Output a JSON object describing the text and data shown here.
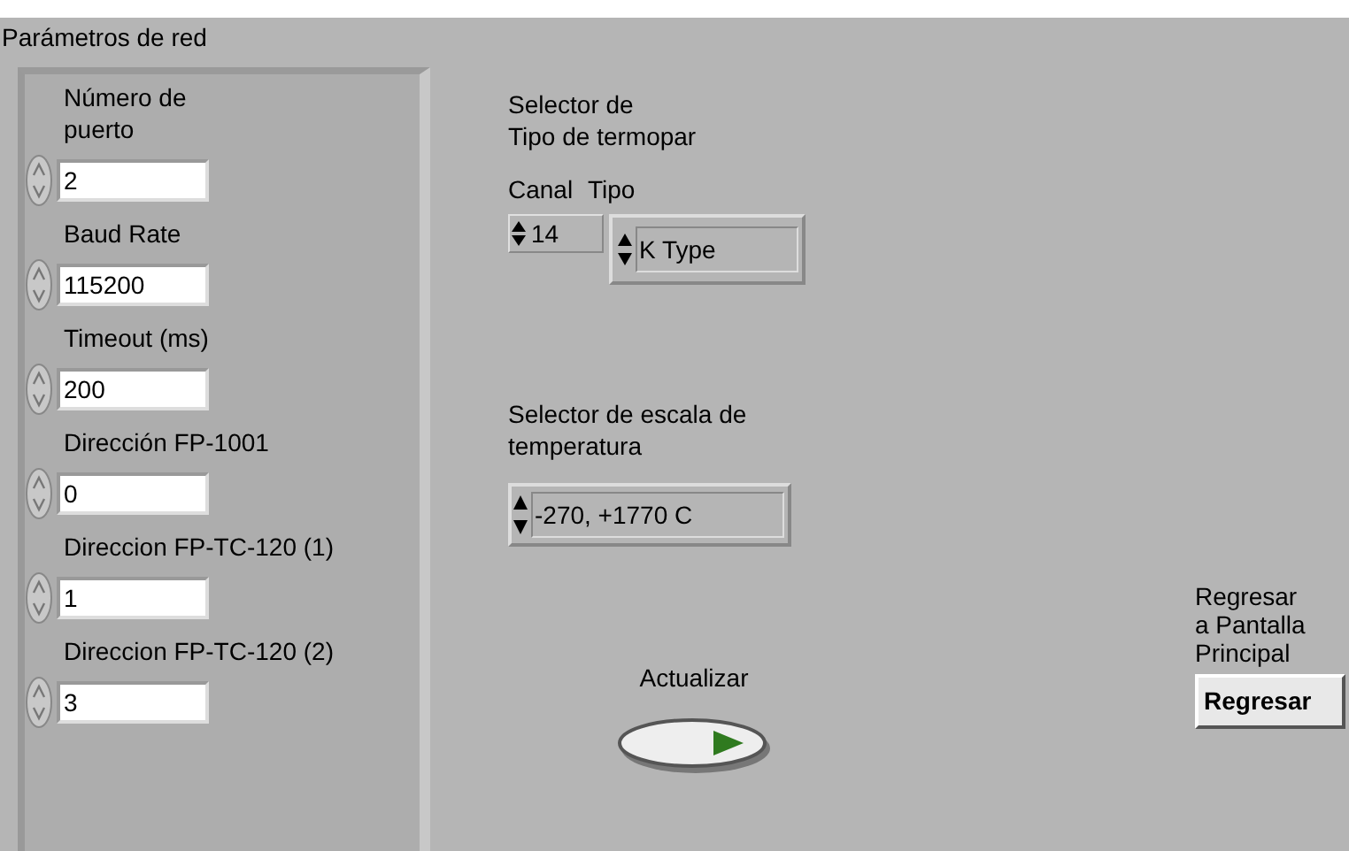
{
  "network_panel": {
    "title": "Parámetros de red",
    "controls": [
      {
        "label": "Número de\npuerto",
        "value": "2"
      },
      {
        "label": "Baud Rate",
        "value": "115200"
      },
      {
        "label": "Timeout (ms)",
        "value": "200"
      },
      {
        "label": "Dirección FP-1001",
        "value": "0"
      },
      {
        "label": "Direccion FP-TC-120 (1)",
        "value": "1"
      },
      {
        "label": "Direccion FP-TC-120 (2)",
        "value": "3"
      }
    ]
  },
  "thermocouple_selector": {
    "title": "Selector de\nTipo de termopar",
    "channel_label": "Canal",
    "type_label": "Tipo",
    "channel_value": "14",
    "type_value": "K Type"
  },
  "scale_selector": {
    "label": "Selector de escala de\ntemperatura",
    "value": "-270, +1770 C"
  },
  "update": {
    "label": "Actualizar"
  },
  "back": {
    "caption": "Regresar\na Pantalla\nPrincipal",
    "button": "Regresar"
  }
}
